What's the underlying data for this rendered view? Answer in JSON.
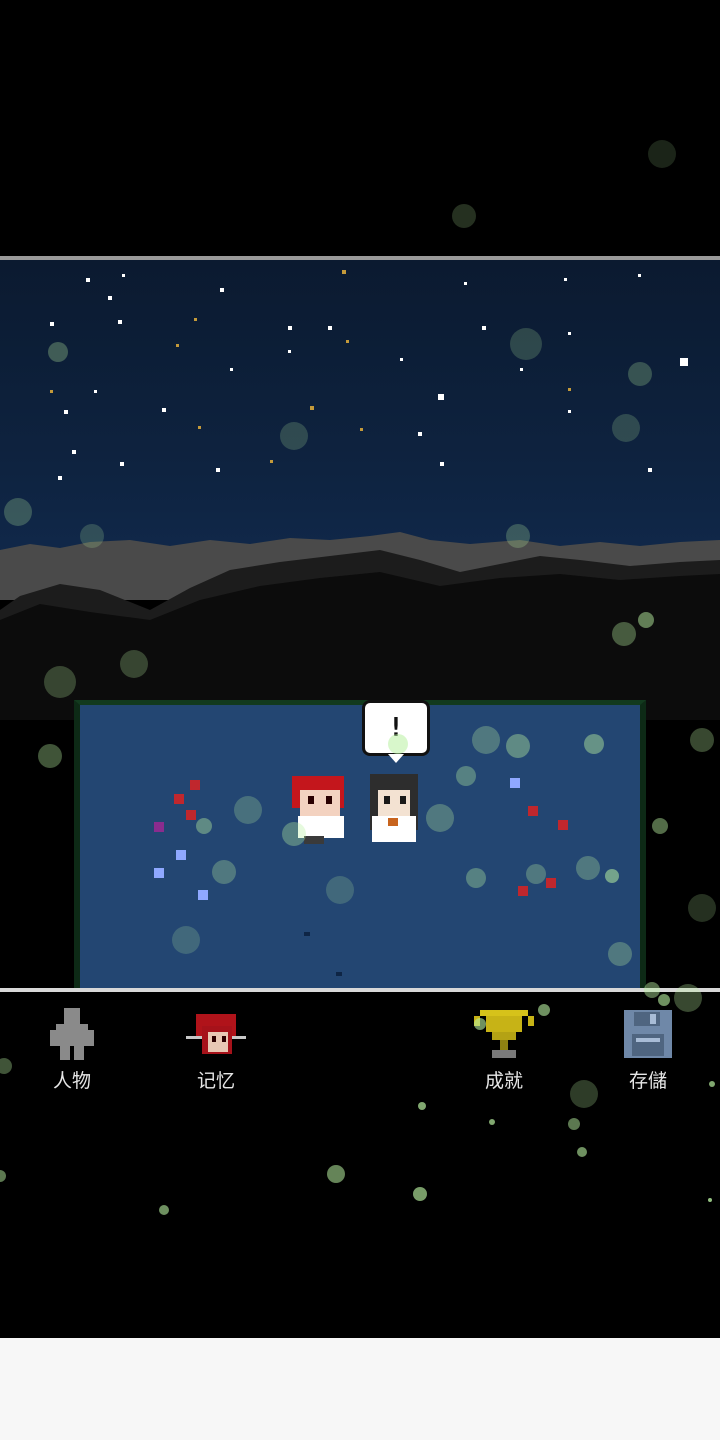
{
  "scene": {
    "speech_bubble_text": "!",
    "colors": {
      "sky": "#0e2340",
      "meadow": "#234672",
      "mountain_ridge": "#3a3a3a",
      "firefly": "#b8f0a0"
    }
  },
  "menu": {
    "items": [
      {
        "label": "人物",
        "icon": "character-icon"
      },
      {
        "label": "记忆",
        "icon": "memory-portrait-icon"
      },
      {
        "label": "成就",
        "icon": "trophy-icon"
      },
      {
        "label": "存儲",
        "icon": "floppy-disk-icon"
      }
    ]
  }
}
